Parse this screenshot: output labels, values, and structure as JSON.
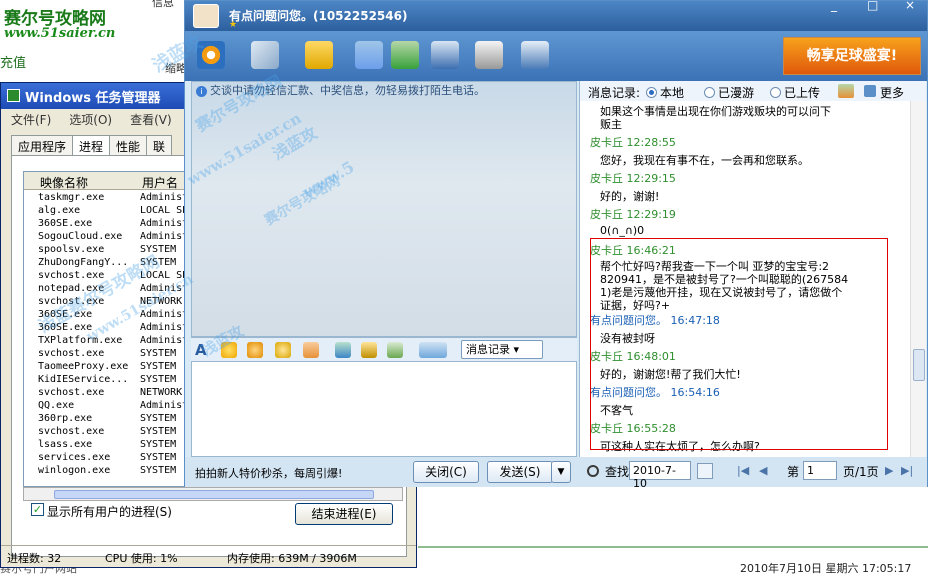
{
  "background": {
    "logo": "赛尔号攻略网",
    "logo_url": "www.51saier.cn",
    "chongzhi": "充值",
    "xinxi": "信息",
    "suolue": "缩略",
    "bottom_text": "赛尔号门户网站",
    "datetime": "2010年7月10日  星期六  17:05:17"
  },
  "watermarks": [
    "浅蓝攻",
    "赛尔号攻略网",
    "www.51saier.cn",
    "浅蓝攻",
    "赛尔号攻略网",
    "www.5",
    "浅蓝赛尔号攻略网",
    "www.51saier.cn",
    "浅蓝攻"
  ],
  "taskmgr": {
    "title": "Windows 任务管理器",
    "menu": [
      "文件(F)",
      "选项(O)",
      "查看(V)",
      "关"
    ],
    "tabs": [
      "应用程序",
      "进程",
      "性能",
      "联"
    ],
    "col_image": "映像名称",
    "col_user": "用户名",
    "processes": [
      {
        "name": "taskmgr.exe",
        "user": "Administ"
      },
      {
        "name": "alg.exe",
        "user": "LOCAL SE"
      },
      {
        "name": "360SE.exe",
        "user": "Administ"
      },
      {
        "name": "SogouCloud.exe",
        "user": "Administ"
      },
      {
        "name": "spoolsv.exe",
        "user": "SYSTEM"
      },
      {
        "name": "ZhuDongFangY...",
        "user": "SYSTEM"
      },
      {
        "name": "svchost.exe",
        "user": "LOCAL SE"
      },
      {
        "name": "notepad.exe",
        "user": "Administ"
      },
      {
        "name": "svchost.exe",
        "user": "NETWORK"
      },
      {
        "name": "360SE.exe",
        "user": "Administ"
      },
      {
        "name": "360SE.exe",
        "user": "Administ"
      },
      {
        "name": "TXPlatform.exe",
        "user": "Administ"
      },
      {
        "name": "svchost.exe",
        "user": "SYSTEM"
      },
      {
        "name": "TaomeeProxy.exe",
        "user": "SYSTEM"
      },
      {
        "name": "KidIEService...",
        "user": "SYSTEM"
      },
      {
        "name": "svchost.exe",
        "user": "NETWORK"
      },
      {
        "name": "QQ.exe",
        "user": "Administ"
      },
      {
        "name": "360rp.exe",
        "user": "SYSTEM"
      },
      {
        "name": "svchost.exe",
        "user": "SYSTEM"
      },
      {
        "name": "lsass.exe",
        "user": "SYSTEM"
      },
      {
        "name": "services.exe",
        "user": "SYSTEM"
      },
      {
        "name": "winlogon.exe",
        "user": "SYSTEM"
      }
    ],
    "show_all_label": "显示所有用户的进程(S)",
    "show_all_checked": "✓",
    "end_process_label": "结束进程(E)",
    "status_procs": "进程数: 32",
    "status_cpu": "CPU 使用: 1%",
    "status_mem": "内存使用: 639M / 3906M"
  },
  "qq": {
    "title": "有点问题问您。(1052252546)",
    "star": "★",
    "win_buttons": [
      "_",
      "□",
      "×"
    ],
    "ad_text": "畅享足球盛宴!",
    "notice": "交谈中请勿轻信汇款、中奖信息，勿轻易拨打陌生电话。",
    "notice_icon": "i",
    "history_btn": "消息记录",
    "font_icon": "A",
    "promo": "拍拍新人特价秒杀，每周引爆!",
    "close_btn": "关闭(C)",
    "send_btn": "发送(S)",
    "send_arrow": "▼"
  },
  "history": {
    "label": "消息记录:",
    "opt_local": "本地",
    "opt_roam": "已漫游",
    "opt_upload": "已上传",
    "more": "更多",
    "search": "查找",
    "date": "2010-7-10",
    "nav_first": "|◀",
    "nav_prev": "◀",
    "page_label": "第",
    "page": "1",
    "page_total": "页/1页",
    "nav_next": "▶",
    "nav_last": "▶|",
    "lines": [
      {
        "kind": "text",
        "text": "如果这个事情是出现在你们游戏贩块的可以问下"
      },
      {
        "kind": "text",
        "text": "贩主"
      },
      {
        "kind": "sender",
        "text": "皮卡丘  12:28:55"
      },
      {
        "kind": "text",
        "text": "您好，我现在有事不在，一会再和您联系。"
      },
      {
        "kind": "sender",
        "text": "皮卡丘  12:29:15"
      },
      {
        "kind": "text",
        "text": "好的，谢谢!"
      },
      {
        "kind": "sender",
        "text": "皮卡丘  12:29:19"
      },
      {
        "kind": "text",
        "text": "0(∩_∩)0"
      },
      {
        "kind": "sender",
        "text": "皮卡丘  16:46:21"
      },
      {
        "kind": "text",
        "text": "帮个忙好吗?帮我查一下一个叫  亚梦的宝宝号:2"
      },
      {
        "kind": "text",
        "text": "820941，是不是被封号了?一个叫聪聪的(267584"
      },
      {
        "kind": "text",
        "text": "1)老是污蔑他开挂，现在又说被封号了，请您做个"
      },
      {
        "kind": "text",
        "text": "证据，好吗?+"
      },
      {
        "kind": "me",
        "text": "有点问题问您。  16:47:18"
      },
      {
        "kind": "text",
        "text": "没有被封呀"
      },
      {
        "kind": "sender",
        "text": "皮卡丘  16:48:01"
      },
      {
        "kind": "text",
        "text": "好的，谢谢您!帮了我们大忙!"
      },
      {
        "kind": "me",
        "text": "有点问题问您。  16:54:16"
      },
      {
        "kind": "text",
        "text": "不客气"
      },
      {
        "kind": "sender",
        "text": "皮卡丘  16:55:28"
      },
      {
        "kind": "text",
        "text": "可这种人实在太烦了，怎么办啊?"
      }
    ]
  },
  "colors": {
    "qq_title": "#2d5f9e",
    "sender_green": "#2f8f2f",
    "me_blue": "#1a5fb4",
    "highlight_red": "#e00000"
  }
}
